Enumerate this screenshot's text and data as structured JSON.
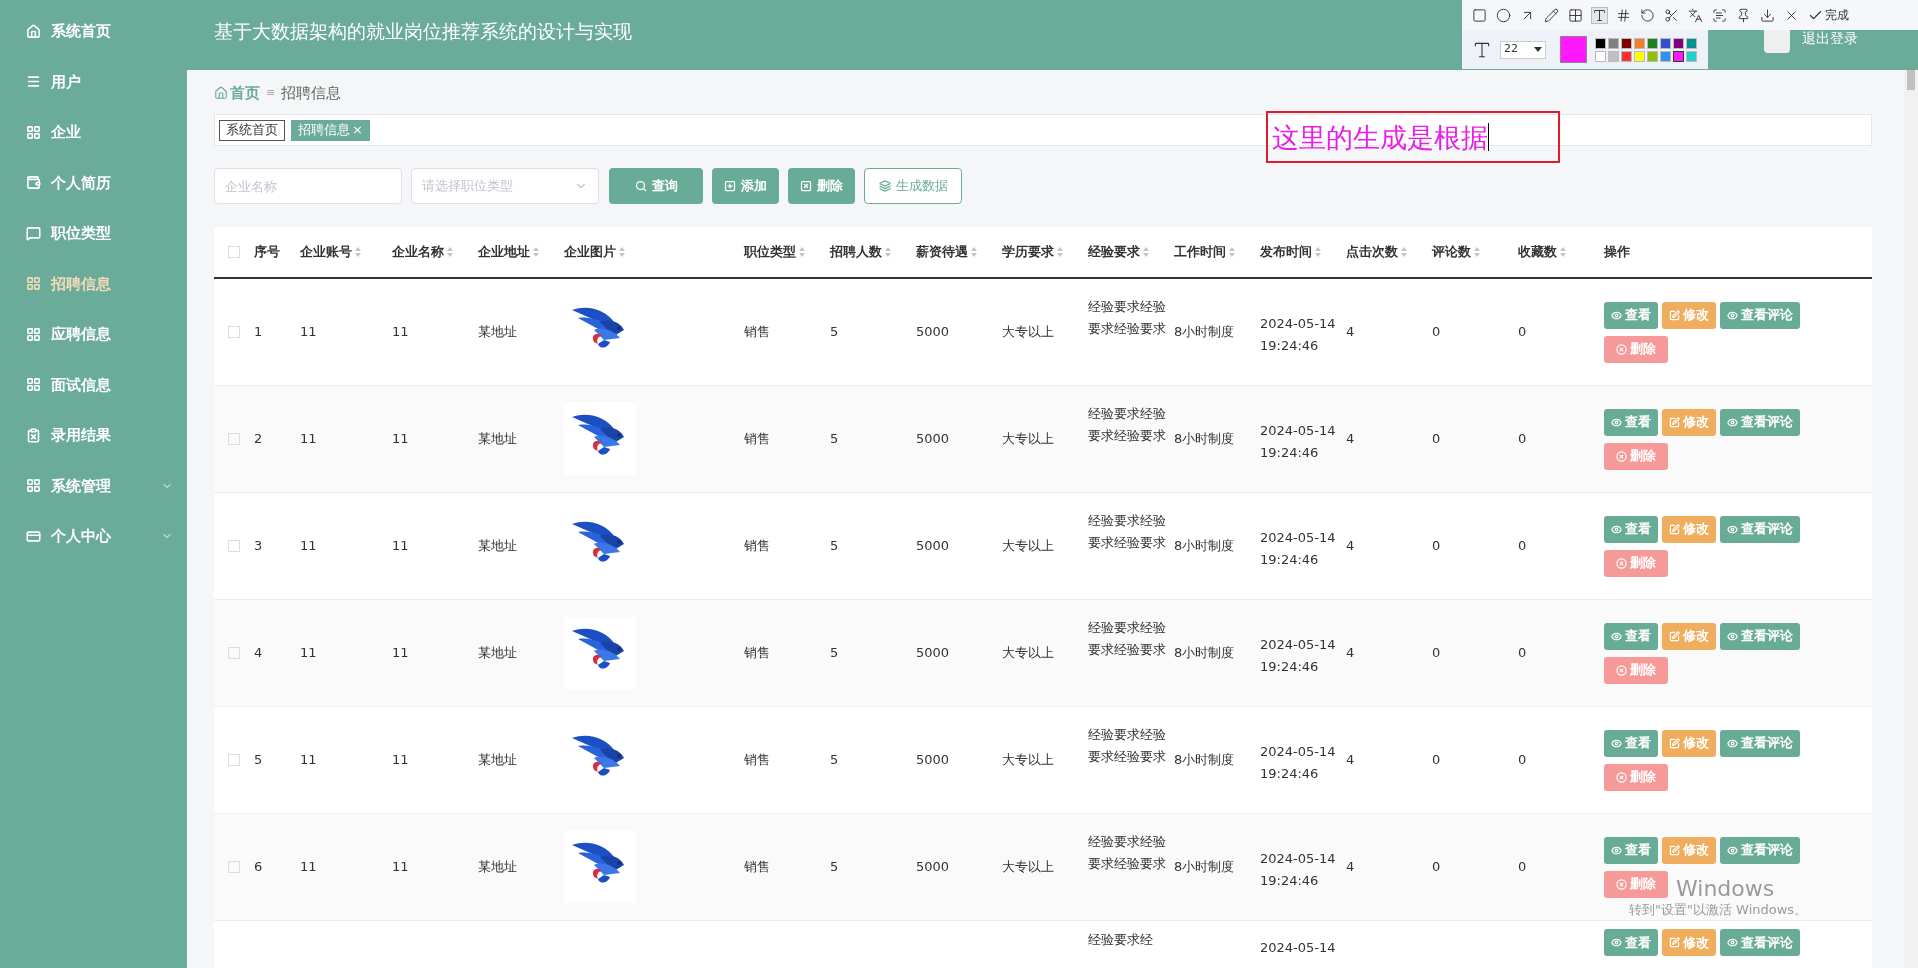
{
  "sidebar": {
    "items": [
      {
        "label": "系统首页",
        "selected": false,
        "expandable": false
      },
      {
        "label": "用户",
        "selected": false,
        "expandable": false
      },
      {
        "label": "企业",
        "selected": false,
        "expandable": false
      },
      {
        "label": "个人简历",
        "selected": false,
        "expandable": false
      },
      {
        "label": "职位类型",
        "selected": false,
        "expandable": false
      },
      {
        "label": "招聘信息",
        "selected": true,
        "expandable": false
      },
      {
        "label": "应聘信息",
        "selected": false,
        "expandable": false
      },
      {
        "label": "面试信息",
        "selected": false,
        "expandable": false
      },
      {
        "label": "录用结果",
        "selected": false,
        "expandable": false
      },
      {
        "label": "系统管理",
        "selected": false,
        "expandable": true
      },
      {
        "label": "个人中心",
        "selected": false,
        "expandable": true
      }
    ]
  },
  "header": {
    "title": "基于大数据架构的就业岗位推荐系统的设计与实现",
    "logout": "退出登录"
  },
  "breadcrumb": {
    "home": "首页",
    "separator": "≡",
    "current": "招聘信息"
  },
  "tags": [
    {
      "label": "系统首页",
      "selected": false,
      "closable": false
    },
    {
      "label": "招聘信息",
      "selected": true,
      "closable": true,
      "close": "×"
    }
  ],
  "filters": {
    "company_name": {
      "placeholder": "企业名称"
    },
    "job_type": {
      "placeholder": "请选择职位类型"
    }
  },
  "buttons": [
    {
      "kind": "search",
      "label": "查询"
    },
    {
      "kind": "add",
      "label": "添加"
    },
    {
      "kind": "delete",
      "label": "删除"
    },
    {
      "kind": "generate",
      "label": "生成数据"
    }
  ],
  "table": {
    "select_all": {
      "checked": false
    },
    "columns": [
      {
        "label": "序号",
        "sortable": false
      },
      {
        "label": "企业账号",
        "sortable": true
      },
      {
        "label": "企业名称",
        "sortable": true
      },
      {
        "label": "企业地址",
        "sortable": true
      },
      {
        "label": "企业图片",
        "sortable": true
      },
      {
        "label": "职位类型",
        "sortable": true
      },
      {
        "label": "招聘人数",
        "sortable": true
      },
      {
        "label": "薪资待遇",
        "sortable": true
      },
      {
        "label": "学历要求",
        "sortable": true
      },
      {
        "label": "经验要求",
        "sortable": true
      },
      {
        "label": "工作时间",
        "sortable": true
      },
      {
        "label": "发布时间",
        "sortable": true
      },
      {
        "label": "点击次数",
        "sortable": true
      },
      {
        "label": "评论数",
        "sortable": true
      },
      {
        "label": "收藏数",
        "sortable": true
      },
      {
        "label": "操作",
        "sortable": false
      }
    ],
    "rows": [
      {
        "checked": false,
        "cells": [
          "1",
          "11",
          "11",
          "某地址",
          null,
          "销售",
          "5",
          "5000",
          "大专以上",
          "经验要求经验要求经验要求",
          "8小时制度",
          "2024-05-14 19:24:46",
          "4",
          "0",
          "0"
        ],
        "actions": [
          "查看",
          "修改",
          "查看评论",
          "删除"
        ]
      },
      {
        "checked": false,
        "cells": [
          "2",
          "11",
          "11",
          "某地址",
          null,
          "销售",
          "5",
          "5000",
          "大专以上",
          "经验要求经验要求经验要求",
          "8小时制度",
          "2024-05-14 19:24:46",
          "4",
          "0",
          "0"
        ],
        "actions": [
          "查看",
          "修改",
          "查看评论",
          "删除"
        ]
      },
      {
        "checked": false,
        "cells": [
          "3",
          "11",
          "11",
          "某地址",
          null,
          "销售",
          "5",
          "5000",
          "大专以上",
          "经验要求经验要求经验要求",
          "8小时制度",
          "2024-05-14 19:24:46",
          "4",
          "0",
          "0"
        ],
        "actions": [
          "查看",
          "修改",
          "查看评论",
          "删除"
        ]
      },
      {
        "checked": false,
        "cells": [
          "4",
          "11",
          "11",
          "某地址",
          null,
          "销售",
          "5",
          "5000",
          "大专以上",
          "经验要求经验要求经验要求",
          "8小时制度",
          "2024-05-14 19:24:46",
          "4",
          "0",
          "0"
        ],
        "actions": [
          "查看",
          "修改",
          "查看评论",
          "删除"
        ]
      },
      {
        "checked": false,
        "cells": [
          "5",
          "11",
          "11",
          "某地址",
          null,
          "销售",
          "5",
          "5000",
          "大专以上",
          "经验要求经验要求经验要求",
          "8小时制度",
          "2024-05-14 19:24:46",
          "4",
          "0",
          "0"
        ],
        "actions": [
          "查看",
          "修改",
          "查看评论",
          "删除"
        ]
      },
      {
        "checked": false,
        "cells": [
          "6",
          "11",
          "11",
          "某地址",
          null,
          "销售",
          "5",
          "5000",
          "大专以上",
          "经验要求经验要求经验要求",
          "8小时制度",
          "2024-05-14 19:24:46",
          "4",
          "0",
          "0"
        ],
        "actions": [
          "查看",
          "修改",
          "查看评论",
          "删除"
        ]
      },
      {
        "cells": [
          null,
          null,
          null,
          null,
          null,
          null,
          null,
          null,
          null,
          "经验要求经",
          null,
          "2024-05-14",
          null,
          null,
          null
        ],
        "actions": [
          "查看",
          "修改",
          "查看评论"
        ]
      }
    ]
  },
  "capture_toolbar": {
    "done": "完成",
    "font_size": "22",
    "palette": [
      {
        "color": "#000000",
        "selected": false
      },
      {
        "color": "#808080",
        "selected": false
      },
      {
        "color": "#800000",
        "selected": false
      },
      {
        "color": "#f08030",
        "selected": false
      },
      {
        "color": "#208020",
        "selected": false
      },
      {
        "color": "#3050d0",
        "selected": false
      },
      {
        "color": "#800080",
        "selected": false
      },
      {
        "color": "#009090",
        "selected": false
      },
      {
        "color": "#ffffff",
        "selected": false
      },
      {
        "color": "#c0c0c0",
        "selected": false
      },
      {
        "color": "#ff3030",
        "selected": false
      },
      {
        "color": "#ffff00",
        "selected": false
      },
      {
        "color": "#90c000",
        "selected": false
      },
      {
        "color": "#3090f0",
        "selected": false
      },
      {
        "color": "#ff19ff",
        "selected": true
      },
      {
        "color": "#20d0d0",
        "selected": false
      }
    ]
  },
  "annotation": {
    "text": "这里的生成是根据"
  },
  "os_notice": {
    "title": "Windows",
    "hint": "转到\"设置\"以激活 Windows。"
  }
}
